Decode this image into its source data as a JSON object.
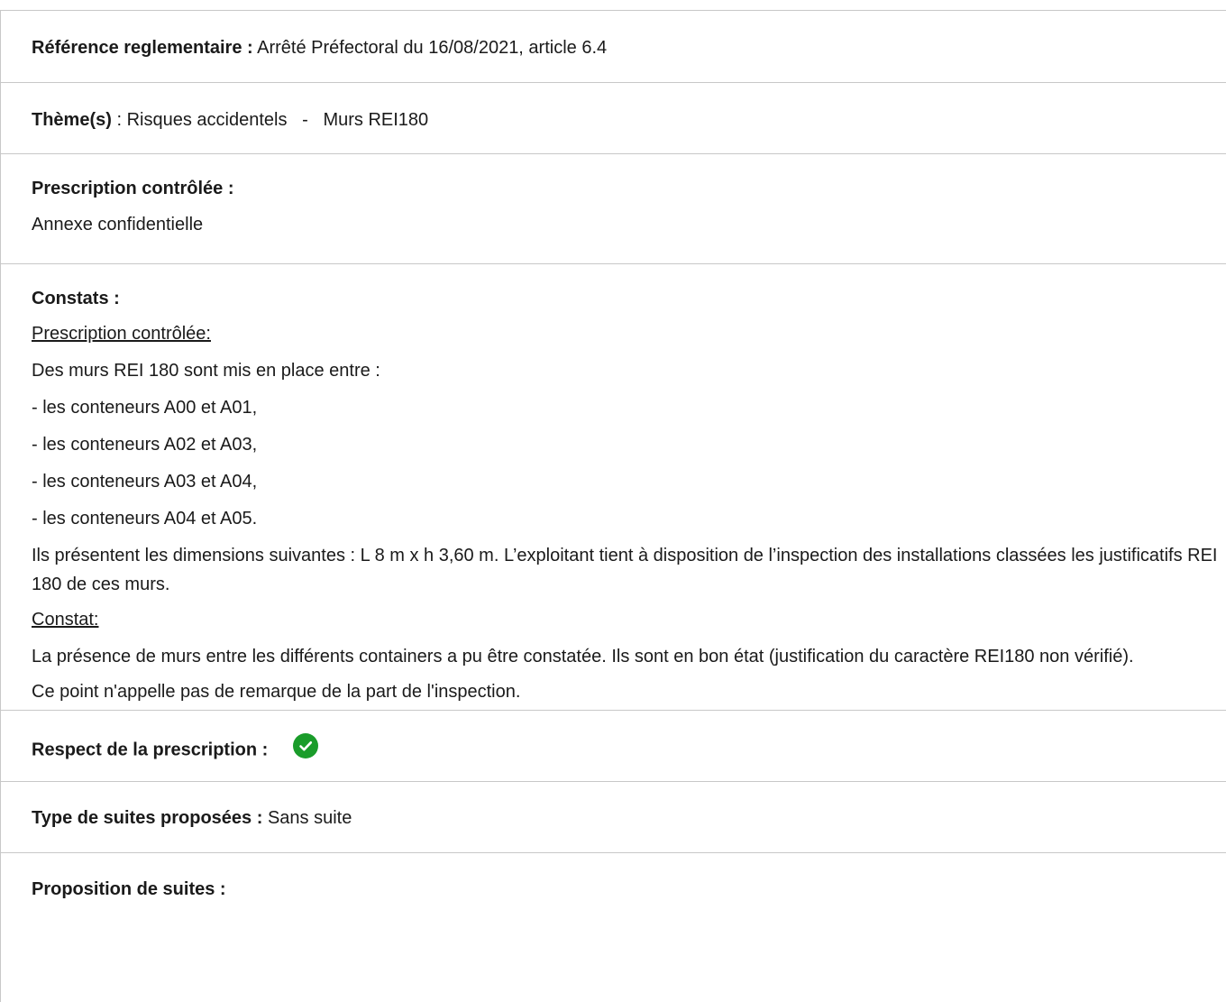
{
  "reference": {
    "label": "Référence reglementaire :",
    "value": "Arrêté Préfectoral du 16/08/2021, article 6.4"
  },
  "themes": {
    "label": "Thème(s)",
    "separator": ":",
    "value": "Risques accidentels   -   Murs REI180"
  },
  "prescription": {
    "label": "Prescription contrôlée :",
    "value": "Annexe confidentielle"
  },
  "constats": {
    "label": "Constats :",
    "sub1_title": "Prescription contrôlée:",
    "intro": "Des murs REI 180 sont mis en place entre :",
    "items": [
      "- les conteneurs A00 et A01,",
      "- les conteneurs A02 et A03,",
      "- les conteneurs A03 et A04,",
      "- les conteneurs A04 et A05."
    ],
    "dimensions_text": "Ils présentent les dimensions suivantes : L 8 m x h 3,60 m. L’exploitant tient à disposition de l’inspection des installations classées les justificatifs REI 180 de ces murs.",
    "sub2_title": "Constat:",
    "finding_text": "La présence de murs entre les différents containers a pu être constatée. Ils sont en bon état (justification du caractère REI180 non vérifié).",
    "conclusion": "Ce point n'appelle pas de remarque de la part de l'inspection."
  },
  "respect": {
    "label": "Respect de la prescription :",
    "icon": "check-circle-icon",
    "color": "#1a9c2a"
  },
  "type_suites": {
    "label": "Type de suites proposées :",
    "value": "Sans suite"
  },
  "proposition": {
    "label": "Proposition de suites :"
  }
}
